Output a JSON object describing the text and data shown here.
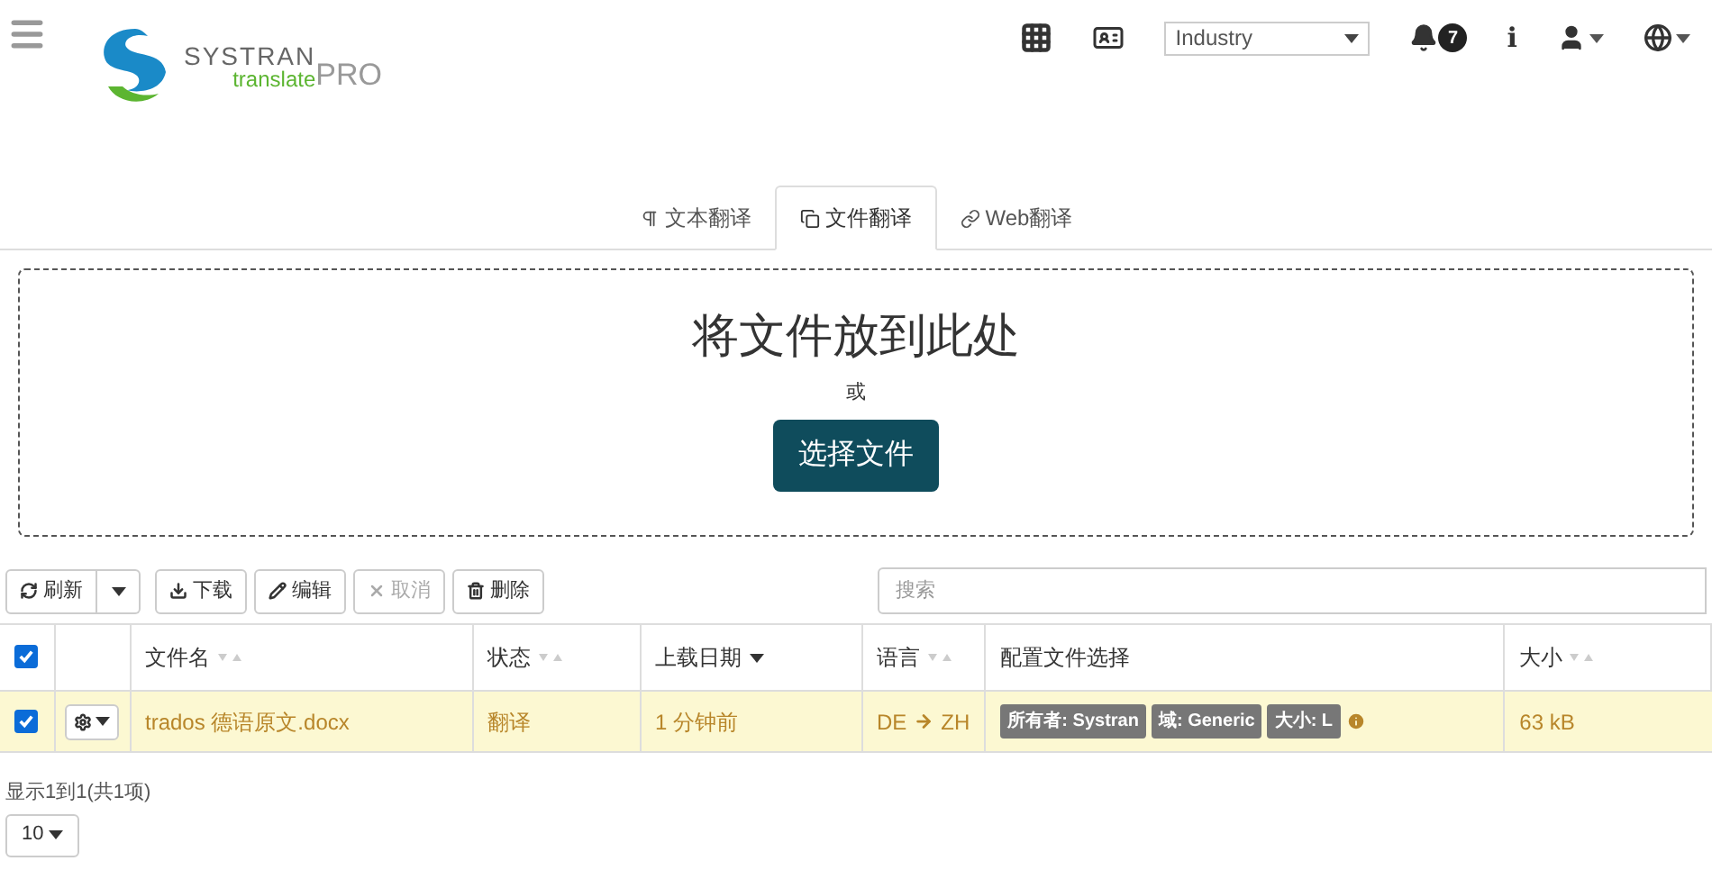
{
  "header": {
    "logo": {
      "brand": "SYSTRAN",
      "product": "translate",
      "edition": "PRO"
    },
    "domain_select": {
      "value": "Industry"
    },
    "notifications": {
      "count": "7"
    },
    "info": {
      "label": "i"
    }
  },
  "tabs": [
    {
      "kind": "text",
      "label": "文本翻译",
      "selected": false
    },
    {
      "kind": "file",
      "label": "文件翻译",
      "selected": true
    },
    {
      "kind": "web",
      "label": "Web翻译",
      "selected": false
    }
  ],
  "dropzone": {
    "title": "将文件放到此处",
    "or": "或",
    "button": "选择文件"
  },
  "toolbar": {
    "buttons": [
      {
        "kind": "refresh",
        "label": "刷新",
        "disabled": false
      },
      {
        "kind": "download",
        "label": "下载",
        "disabled": false
      },
      {
        "kind": "edit",
        "label": "编辑",
        "disabled": false
      },
      {
        "kind": "cancel",
        "label": "取消",
        "disabled": true
      },
      {
        "kind": "delete",
        "label": "删除",
        "disabled": false
      }
    ],
    "search": {
      "placeholder": "搜索"
    }
  },
  "table": {
    "all_checked": true,
    "columns": [
      {
        "label": "文件名",
        "kind": "sortable"
      },
      {
        "label": "状态",
        "kind": "sortable"
      },
      {
        "label": "上载日期",
        "kind": "sorted_desc"
      },
      {
        "label": "语言",
        "kind": "sortable"
      },
      {
        "label": "配置文件选择",
        "kind": "plain"
      },
      {
        "label": "大小",
        "kind": "sortable"
      }
    ],
    "rows": [
      {
        "checked": true,
        "file": "trados 德语原文.docx",
        "status": "翻译",
        "uploaded": "1 分钟前",
        "source": "DE",
        "target": "ZH",
        "profile_tags": [
          "所有者: Systran",
          "域: Generic",
          "大小: L"
        ],
        "size": "63 kB"
      }
    ]
  },
  "footer": {
    "summary": "显示1到1(共1项)",
    "page_size": "10"
  }
}
